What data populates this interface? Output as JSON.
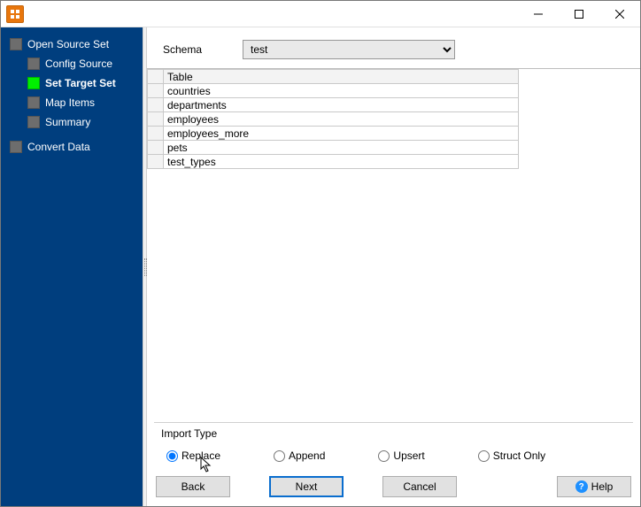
{
  "sidebar": {
    "items": [
      {
        "label": "Open Source Set",
        "level": 0,
        "active": false
      },
      {
        "label": "Config Source",
        "level": 1,
        "active": false
      },
      {
        "label": "Set Target Set",
        "level": 1,
        "active": true
      },
      {
        "label": "Map Items",
        "level": 1,
        "active": false
      },
      {
        "label": "Summary",
        "level": 1,
        "active": false
      },
      {
        "label": "Convert Data",
        "level": 0,
        "active": false
      }
    ]
  },
  "schema": {
    "label": "Schema",
    "selected": "test"
  },
  "table": {
    "header": "Table",
    "rows": [
      "countries",
      "departments",
      "employees",
      "employees_more",
      "pets",
      "test_types"
    ]
  },
  "import_type": {
    "legend": "Import Type",
    "options": [
      {
        "label": "Replace",
        "checked": true
      },
      {
        "label": "Append",
        "checked": false
      },
      {
        "label": "Upsert",
        "checked": false
      },
      {
        "label": "Struct Only",
        "checked": false
      }
    ]
  },
  "buttons": {
    "back": "Back",
    "next": "Next",
    "cancel": "Cancel",
    "help": "Help"
  }
}
